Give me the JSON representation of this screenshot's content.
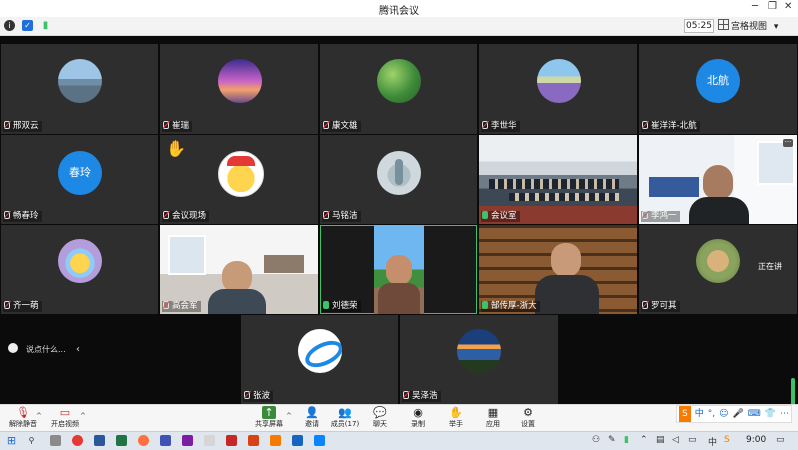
{
  "window": {
    "title": "腾讯会议",
    "minimize": "─",
    "restore": "❐",
    "close": "✕"
  },
  "infobar": {
    "timer": "05:25",
    "grid_view_label": "宫格视图",
    "grid_view_caret": "▾"
  },
  "participants": [
    {
      "name": "邢双云",
      "avatar": "photo-harbor-avatar"
    },
    {
      "name": "崔瑞",
      "avatar": "photo-sunset-avatar"
    },
    {
      "name": "康文雄",
      "avatar": "photo-leaves-avatar"
    },
    {
      "name": "李世华",
      "avatar": "photo-lavender-avatar"
    },
    {
      "name": "崔洋洋-北航",
      "avatar_text": "北航"
    },
    {
      "name": "畅春玲",
      "avatar_text": "春玲"
    },
    {
      "name": "会议现场",
      "avatar": "cartoon-pikachu-avatar",
      "hand_raised": "✋"
    },
    {
      "name": "马铭洁",
      "avatar": "cartoon-fish-avatar"
    },
    {
      "name": "会议室",
      "video": "conference-room-video"
    },
    {
      "name": "李鸿一",
      "video": "office-man-video",
      "speaking": "正在讲"
    },
    {
      "name": "齐一萌",
      "avatar": "cartoon-bear-avatar"
    },
    {
      "name": "高会军",
      "video": "living-room-video"
    },
    {
      "name": "刘德荣",
      "video": "palm-tree-video"
    },
    {
      "name": "郜传厚-浙大",
      "video": "bookshelf-video"
    },
    {
      "name": "罗可其",
      "avatar": "photo-dog-avatar"
    },
    {
      "name": "张波",
      "avatar": "blue-ribbon-avatar"
    },
    {
      "name": "吴泽浩",
      "avatar": "photo-lake-avatar"
    }
  ],
  "chat": {
    "placeholder": "说点什么...",
    "collapse": "‹"
  },
  "toolbar": {
    "unmute": "解除静音",
    "start_video": "开启视频",
    "share_screen": "共享屏幕",
    "invite": "邀请",
    "members": "成员(17)",
    "chat": "聊天",
    "record": "录制",
    "raise_hand": "举手",
    "apps": "应用",
    "settings": "设置"
  },
  "ime": {
    "logo": "S",
    "lang": "中",
    "punct": "°,",
    "emoji": "☺",
    "voice": "🎤",
    "keyboard": "⌨",
    "skin": "👕",
    "more": "⋯"
  },
  "taskbar": {
    "time": "9:00",
    "input_lang": "中",
    "start": "⊞",
    "search": "⚲"
  },
  "colors": {
    "tile_bg": "#2e2e2e",
    "avatar_blue": "#1e88e5",
    "active_green": "#3cc36a",
    "muted_red": "#e84b4b"
  }
}
